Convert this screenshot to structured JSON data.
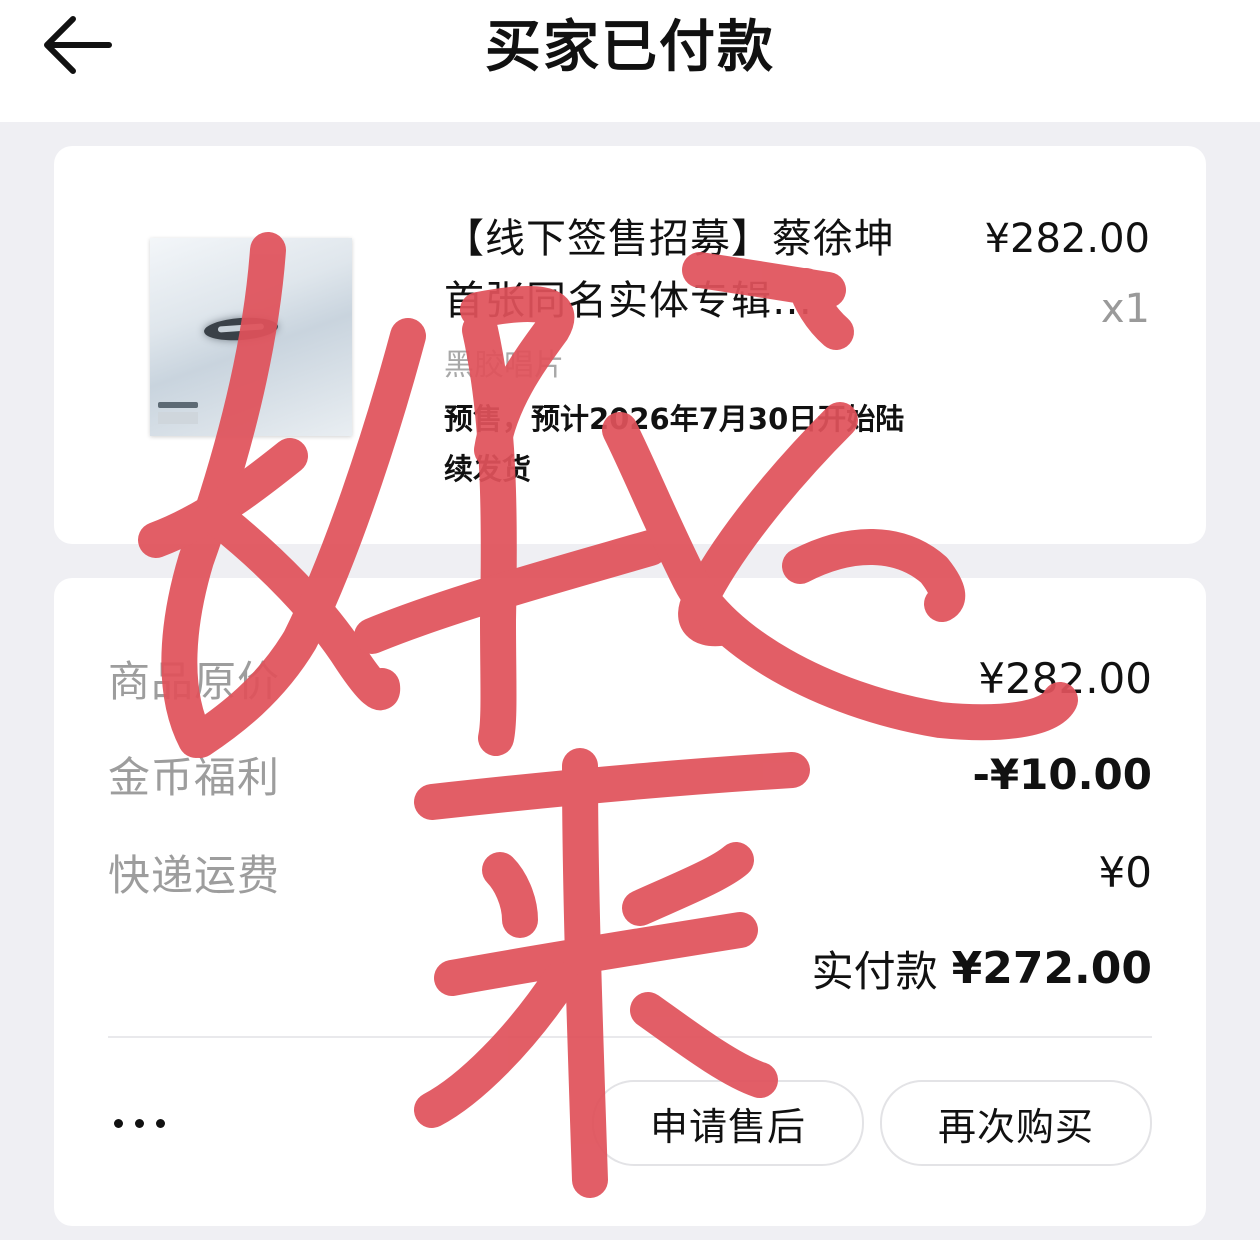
{
  "header": {
    "title": "买家已付款",
    "back_icon": "arrow-left-icon"
  },
  "product": {
    "title": "【线下签售招募】蔡徐坤首张同名实体专辑…",
    "price": "¥282.00",
    "quantity": "x1",
    "variant": "黑胶唱片",
    "note": "预售，预计2026年7月30日开始陆续发货"
  },
  "summary": {
    "rows": [
      {
        "label": "商品原价",
        "value": "¥282.00"
      },
      {
        "label": "金币福利",
        "value": "-¥10.00"
      },
      {
        "label": "快递运费",
        "value": "¥0"
      }
    ],
    "total_label": "实付款",
    "total_value": "¥272.00"
  },
  "actions": {
    "more_icon": "more-dots-icon",
    "after_sale": "申请售后",
    "buy_again": "再次购买"
  },
  "overlay": {
    "handwriting": "好运来",
    "color": "#e0525b"
  }
}
